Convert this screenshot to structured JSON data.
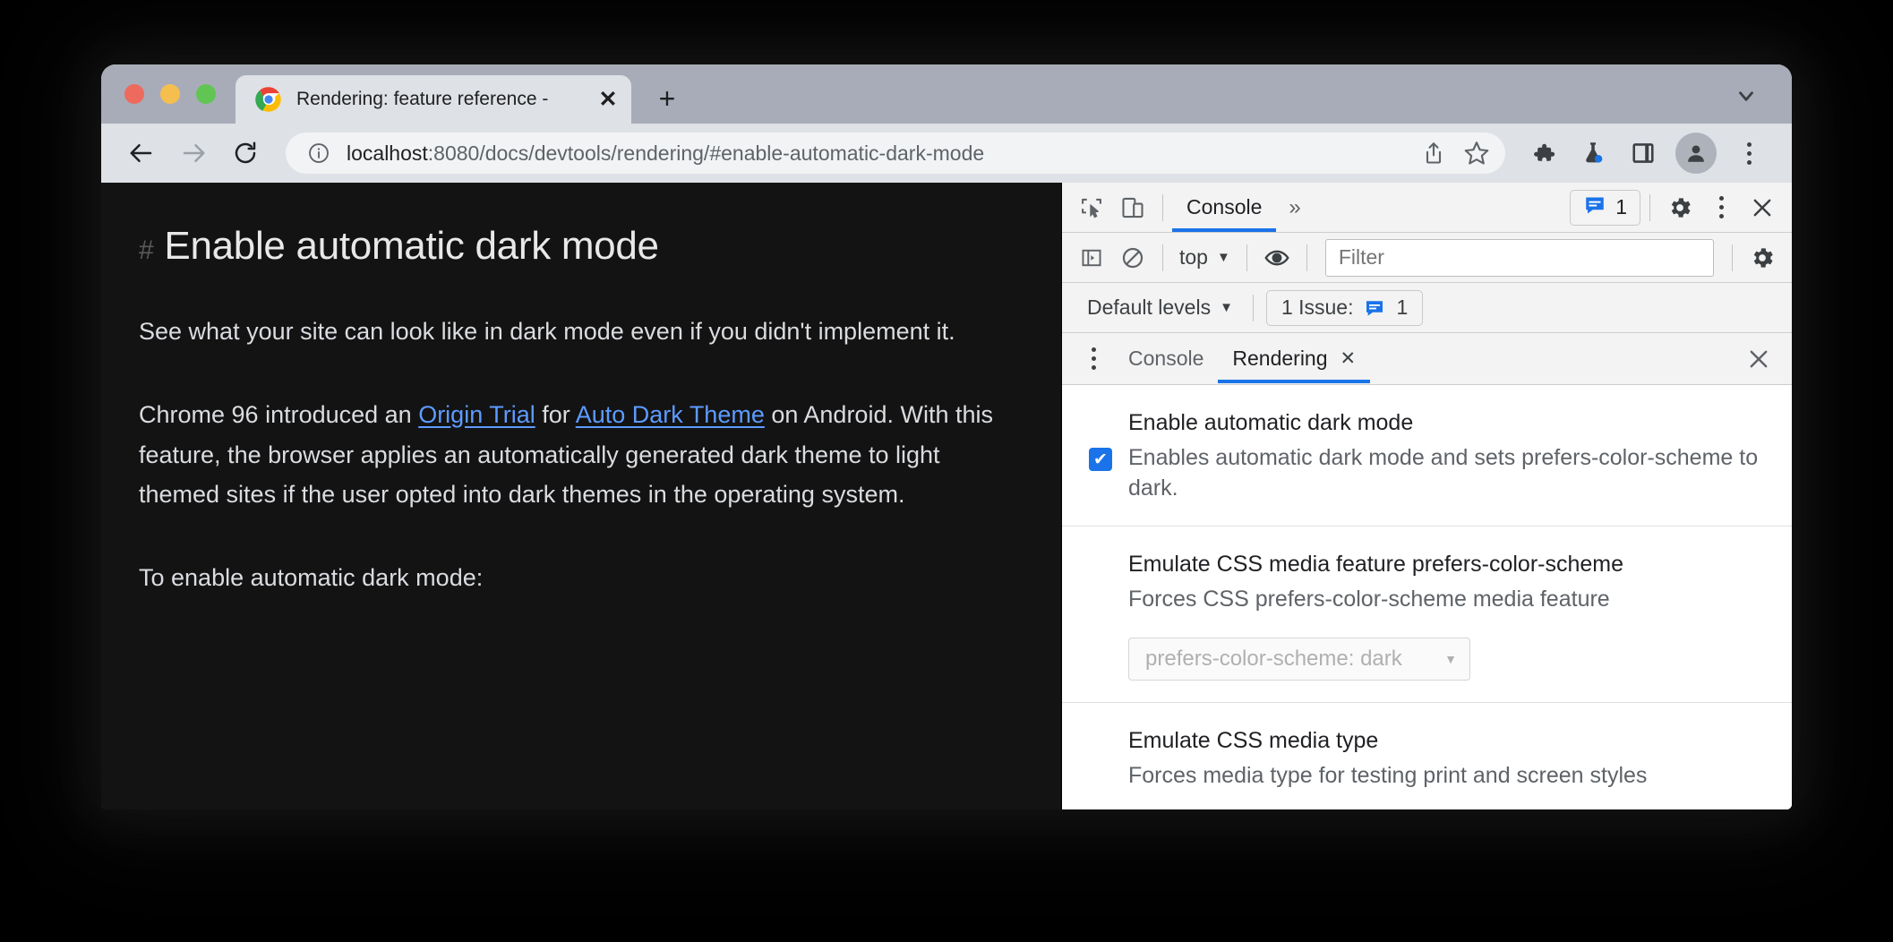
{
  "window": {
    "traffic_lights": [
      "close",
      "minimize",
      "maximize"
    ],
    "tab": {
      "title": "Rendering: feature reference -",
      "favicon": "chrome-logo-icon",
      "close_label": "✕"
    },
    "new_tab_label": "+",
    "tab_search_icon": "chevron-down-icon"
  },
  "omnibox": {
    "back_icon": "back-arrow-icon",
    "forward_icon": "forward-arrow-icon",
    "reload_icon": "reload-icon",
    "site_info_icon": "info-circle-icon",
    "url_host": "localhost",
    "url_rest": ":8080/docs/devtools/rendering/#enable-automatic-dark-mode",
    "share_icon": "share-icon",
    "bookmark_icon": "star-icon",
    "extensions_icon": "puzzle-piece-icon",
    "experiments_icon": "flask-icon",
    "side_panel_icon": "side-panel-icon",
    "profile_icon": "avatar-icon",
    "menu_icon": "three-dot-menu-icon"
  },
  "page": {
    "anchor_hash": "#",
    "heading": "Enable automatic dark mode",
    "paragraph1": "See what your site can look like in dark mode even if you didn't implement it.",
    "paragraph2": {
      "pre": "Chrome 96 introduced an ",
      "link1": "Origin Trial",
      "mid": " for ",
      "link2": "Auto Dark Theme",
      "post": " on Android. With this feature, the browser applies an automatically generated dark theme to light themed sites if the user opted into dark themes in the operating system."
    },
    "paragraph3": "To enable automatic dark mode:"
  },
  "devtools": {
    "main_toolbar": {
      "inspect_icon": "inspect-element-icon",
      "device_icon": "device-toolbar-icon",
      "tabs": [
        {
          "label": "Console",
          "active": true
        }
      ],
      "overflow_label": "»",
      "issues_icon": "issues-message-icon",
      "issues_count": "1",
      "settings_icon": "gear-icon",
      "more_icon": "three-dot-menu-icon",
      "close_icon": "close-icon"
    },
    "console_toolbar": {
      "sidebar_icon": "console-sidebar-icon",
      "clear_icon": "clear-console-icon",
      "context_label": "top",
      "eye_icon": "live-expression-icon",
      "filter_placeholder": "Filter",
      "settings_icon": "gear-icon"
    },
    "levels_toolbar": {
      "levels_label": "Default levels",
      "issue_label": "1 Issue:",
      "issue_icon": "issues-message-icon",
      "issue_count": "1"
    },
    "drawer_tabs": {
      "more_icon": "three-dot-menu-icon",
      "tabs": [
        {
          "label": "Console",
          "active": false,
          "closeable": false
        },
        {
          "label": "Rendering",
          "active": true,
          "closeable": true
        }
      ],
      "tab_close_label": "✕",
      "close_icon": "close-icon"
    },
    "rendering": {
      "sections": [
        {
          "title": "Enable automatic dark mode",
          "desc": "Enables automatic dark mode and sets prefers-color-scheme to dark.",
          "checkbox": true,
          "checkbox_glyph": "✔"
        },
        {
          "title": "Emulate CSS media feature prefers-color-scheme",
          "desc": "Forces CSS prefers-color-scheme media feature",
          "select_value": "prefers-color-scheme: dark",
          "select_disabled": true
        },
        {
          "title": "Emulate CSS media type",
          "desc": "Forces media type for testing print and screen styles"
        }
      ]
    }
  },
  "colors": {
    "accent_blue": "#1a73e8",
    "tab_strip": "#a8acb8",
    "toolbar": "#dee1e6",
    "page_dark_bg": "#131313",
    "link_blue": "#5e9bff"
  }
}
